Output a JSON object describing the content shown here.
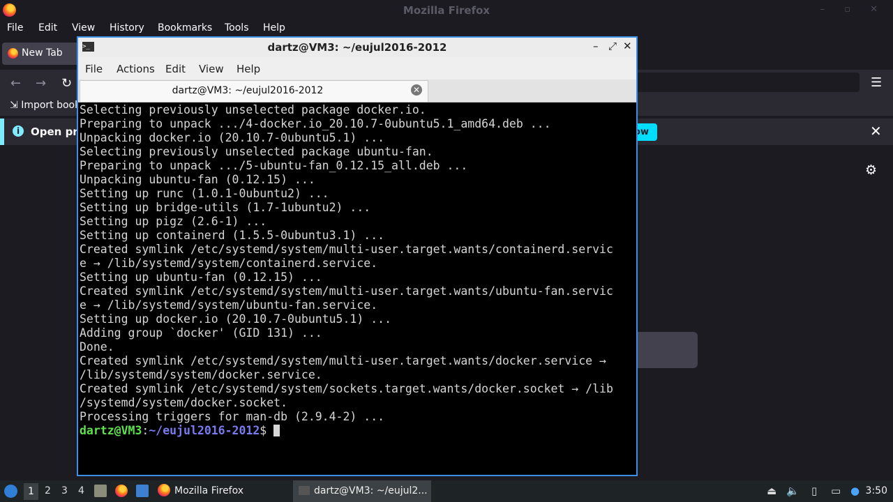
{
  "firefox": {
    "window_title": "Mozilla Firefox",
    "menu": [
      "File",
      "Edit",
      "View",
      "History",
      "Bookmarks",
      "Tools",
      "Help"
    ],
    "tab_label": "New Tab",
    "bookmarks_import": "Import book",
    "notification_text": "Open pre",
    "notification_button": "ow"
  },
  "terminal": {
    "window_title": "dartz@VM3: ~/eujul2016-2012",
    "menu": [
      "File",
      "Actions",
      "Edit",
      "View",
      "Help"
    ],
    "tab_label": "dartz@VM3: ~/eujul2016-2012",
    "lines": [
      "Selecting previously unselected package docker.io.",
      "Preparing to unpack .../4-docker.io_20.10.7-0ubuntu5.1_amd64.deb ...",
      "Unpacking docker.io (20.10.7-0ubuntu5.1) ...",
      "Selecting previously unselected package ubuntu-fan.",
      "Preparing to unpack .../5-ubuntu-fan_0.12.15_all.deb ...",
      "Unpacking ubuntu-fan (0.12.15) ...",
      "Setting up runc (1.0.1-0ubuntu2) ...",
      "Setting up bridge-utils (1.7-1ubuntu2) ...",
      "Setting up pigz (2.6-1) ...",
      "Setting up containerd (1.5.5-0ubuntu3.1) ...",
      "Created symlink /etc/systemd/system/multi-user.target.wants/containerd.servic",
      "e → /lib/systemd/system/containerd.service.",
      "Setting up ubuntu-fan (0.12.15) ...",
      "Created symlink /etc/systemd/system/multi-user.target.wants/ubuntu-fan.servic",
      "e → /lib/systemd/system/ubuntu-fan.service.",
      "Setting up docker.io (20.10.7-0ubuntu5.1) ...",
      "Adding group `docker' (GID 131) ...",
      "Done.",
      "Created symlink /etc/systemd/system/multi-user.target.wants/docker.service →",
      "/lib/systemd/system/docker.service.",
      "Created symlink /etc/systemd/system/sockets.target.wants/docker.socket → /lib",
      "/systemd/system/docker.socket.",
      "Processing triggers for man-db (2.9.4-2) ..."
    ],
    "prompt_user": "dartz@VM3",
    "prompt_sep": ":",
    "prompt_path": "~/eujul2016-2012",
    "prompt_symbol": "$ "
  },
  "taskbar": {
    "workspaces": [
      "1",
      "2",
      "3",
      "4"
    ],
    "tasks": [
      "Mozilla Firefox",
      "dartz@VM3: ~/eujul2..."
    ],
    "clock": "3:50"
  }
}
